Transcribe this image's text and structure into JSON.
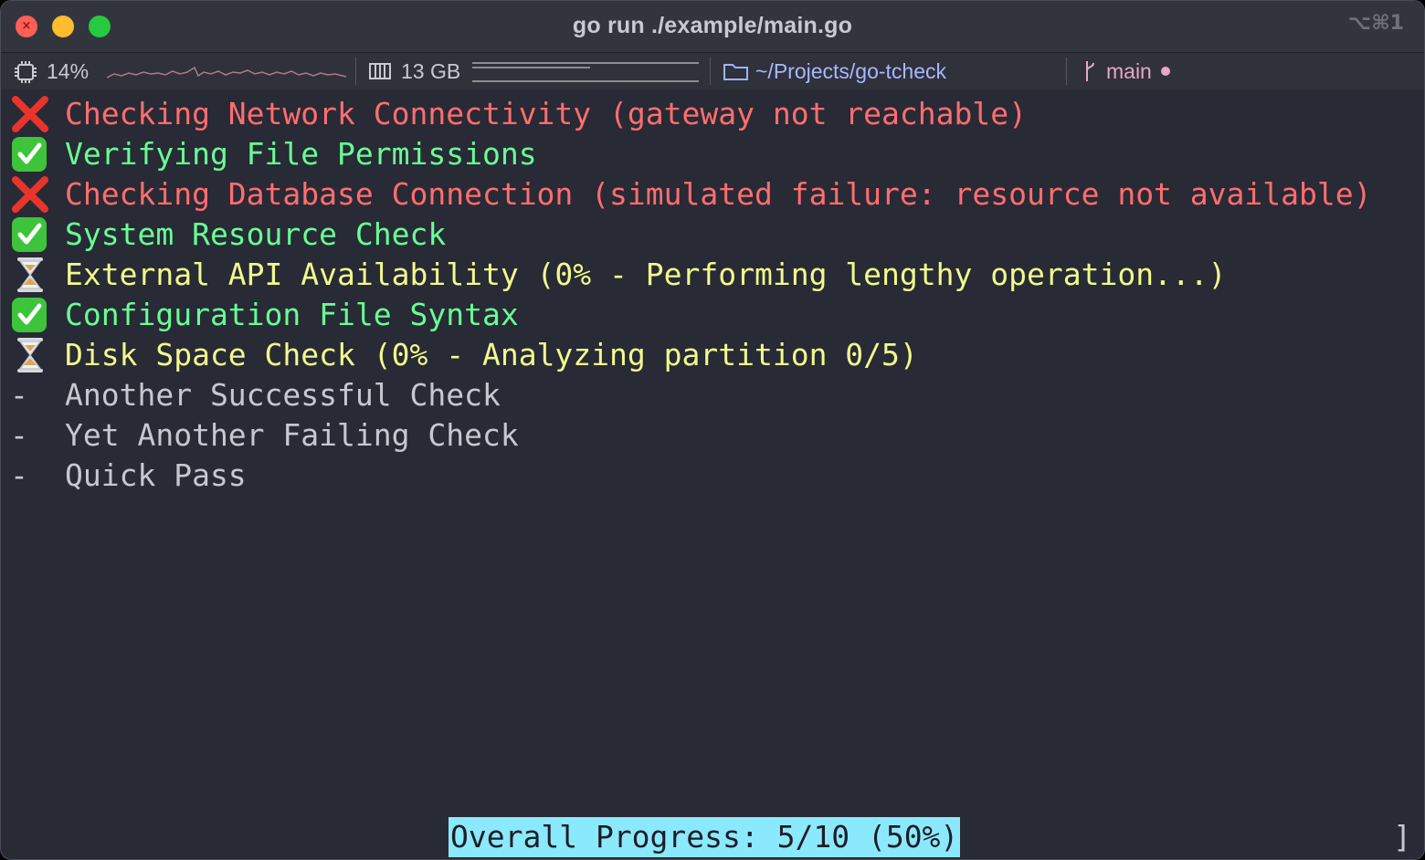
{
  "window": {
    "title": "go run ./example/main.go",
    "shortcut": "⌥⌘1"
  },
  "statusbar": {
    "cpu_label": "14%",
    "memory_label": "13 GB",
    "memory_fraction": 0.52,
    "directory": "~/Projects/go-tcheck",
    "branch": "main"
  },
  "checks": [
    {
      "status": "fail",
      "text": "Checking Network Connectivity (gateway not reachable)"
    },
    {
      "status": "pass",
      "text": "Verifying File Permissions"
    },
    {
      "status": "fail",
      "text": "Checking Database Connection (simulated failure: resource not available)"
    },
    {
      "status": "pass",
      "text": "System Resource Check"
    },
    {
      "status": "running",
      "text": "External API Availability (0% - Performing lengthy operation...)"
    },
    {
      "status": "pass",
      "text": "Configuration File Syntax"
    },
    {
      "status": "running",
      "text": "Disk Space Check (0% - Analyzing partition 0/5)"
    },
    {
      "status": "pending",
      "text": "Another Successful Check"
    },
    {
      "status": "pending",
      "text": "Yet Another Failing Check"
    },
    {
      "status": "pending",
      "text": "Quick Pass"
    }
  ],
  "pending_marker": "-",
  "progress": {
    "left_bracket": "[",
    "bar": "======================",
    "label": "Overall Progress: 5/10 (50%)",
    "right_bracket": "]",
    "fraction": 0.5
  },
  "colors": {
    "fail": "#ff6e6e",
    "pass": "#69ff94",
    "running": "#f1fa8c",
    "pending": "#c6c8d1",
    "progress_highlight": "#8be9fd"
  }
}
